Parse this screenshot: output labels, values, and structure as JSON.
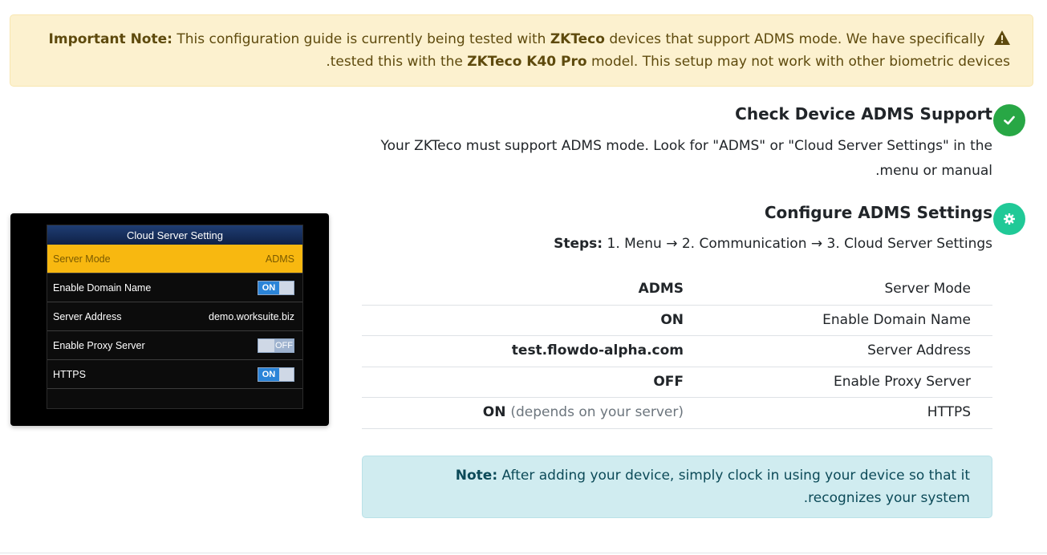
{
  "warning": {
    "label": "Important Note:",
    "line1_a": "This configuration guide is currently being tested with",
    "brand": "ZKTeco",
    "line1_b": "devices that support ADMS mode. We have specifically",
    "line2_a": ".tested this with the",
    "model": "ZKTeco K40 Pro",
    "line2_b": "model. This setup may not work with other biometric devices",
    "icon": "warning-triangle-icon",
    "color": "#fcf1cf"
  },
  "step1": {
    "title": "Check Device ADMS Support",
    "text_line1": "Your ZKTeco must support ADMS mode. Look for \"ADMS\" or \"Cloud Server Settings\" in the",
    "text_line2": ".menu or manual",
    "icon": "check-icon",
    "badge_color": "#28a745"
  },
  "step2": {
    "title": "Configure ADMS Settings",
    "steps_label": "Steps:",
    "steps_text": "1. Menu → 2. Communication → 3. Cloud Server Settings",
    "icon": "gear-icon",
    "badge_color": "#20c997"
  },
  "device_screen": {
    "title": "Cloud Server Setting",
    "rows": [
      {
        "label": "Server Mode",
        "value": "ADMS"
      },
      {
        "label": "Enable Domain Name",
        "value": "ON"
      },
      {
        "label": "Server Address",
        "value": "demo.worksuite.biz"
      },
      {
        "label": "Enable Proxy Server",
        "value": "OFF"
      },
      {
        "label": "HTTPS",
        "value": "ON"
      }
    ]
  },
  "settings_table": [
    {
      "key": "Server Mode",
      "value": "ADMS",
      "sub": ""
    },
    {
      "key": "Enable Domain Name",
      "value": "ON",
      "sub": ""
    },
    {
      "key": "Server Address",
      "value": "test.flowdo-alpha.com",
      "sub": ""
    },
    {
      "key": "Enable Proxy Server",
      "value": "OFF",
      "sub": ""
    },
    {
      "key": "HTTPS",
      "value": "ON",
      "sub": "(depends on your server)"
    }
  ],
  "note": {
    "label": "Note:",
    "line1": "After adding your device, simply clock in using your device so that it",
    "line2": ".recognizes your system"
  }
}
